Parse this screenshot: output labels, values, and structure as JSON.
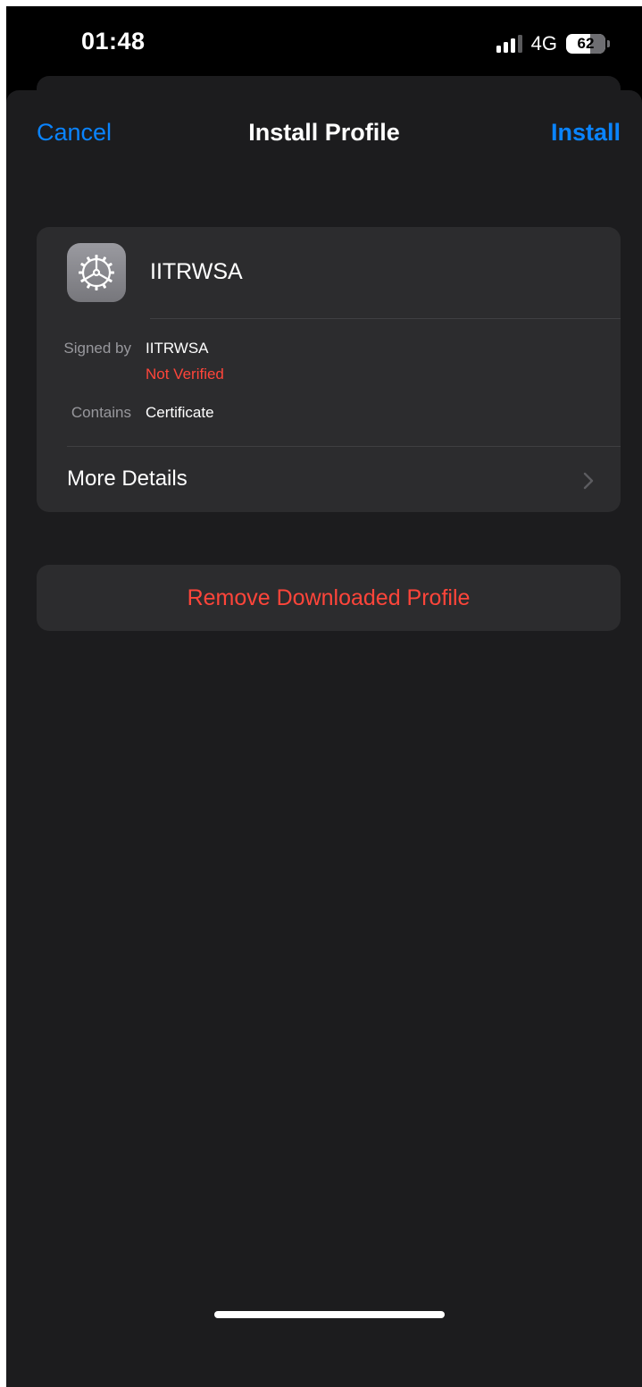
{
  "status_bar": {
    "time": "01:48",
    "network": "4G",
    "battery_percent": "62",
    "battery_level": 0.62,
    "signal_bars_active": 3,
    "signal_bars_total": 4
  },
  "nav": {
    "cancel_label": "Cancel",
    "title": "Install Profile",
    "install_label": "Install"
  },
  "profile": {
    "icon": "gear-icon",
    "name": "IITRWSA",
    "signed_by_label": "Signed by",
    "signed_by_value": "IITRWSA",
    "verification_status": "Not Verified",
    "contains_label": "Contains",
    "contains_value": "Certificate",
    "more_details_label": "More Details"
  },
  "actions": {
    "remove_label": "Remove Downloaded Profile"
  },
  "colors": {
    "accent_blue": "#0a84ff",
    "destructive_red": "#ff453a",
    "sheet_background": "#1c1c1e",
    "card_background": "#2c2c2e"
  }
}
